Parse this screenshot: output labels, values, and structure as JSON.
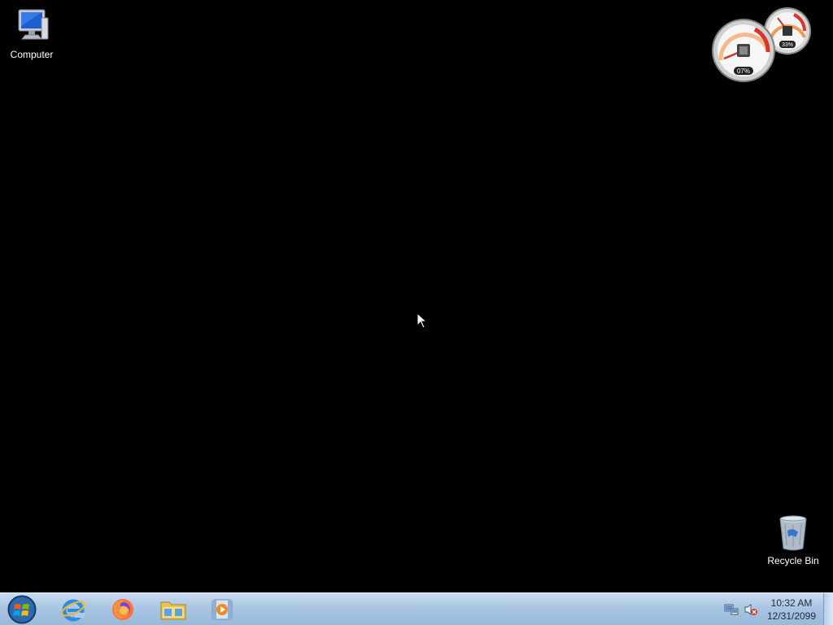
{
  "desktop": {
    "icons": [
      {
        "label": "Computer",
        "icon": "computer-icon"
      },
      {
        "label": "Recycle Bin",
        "icon": "recycle-bin-icon"
      }
    ]
  },
  "gadget": {
    "cpu_percent_label": "07%",
    "memory_percent_label": "33%",
    "cpu_percent": 7,
    "memory_percent": 33
  },
  "taskbar": {
    "start_icon": "windows-logo-icon",
    "pinned": [
      {
        "icon": "internet-explorer-icon"
      },
      {
        "icon": "firefox-icon"
      },
      {
        "icon": "file-explorer-icon"
      },
      {
        "icon": "media-player-icon"
      }
    ],
    "tray": {
      "network_icon": "network-icon",
      "volume_icon": "volume-muted-icon",
      "time": "10:32 AM",
      "date": "12/31/2099"
    }
  },
  "colors": {
    "desktop_background": "#000000",
    "taskbar_top": "#c9dcef",
    "taskbar_bottom": "#98b9d9",
    "gauge_red": "#d9362b"
  }
}
